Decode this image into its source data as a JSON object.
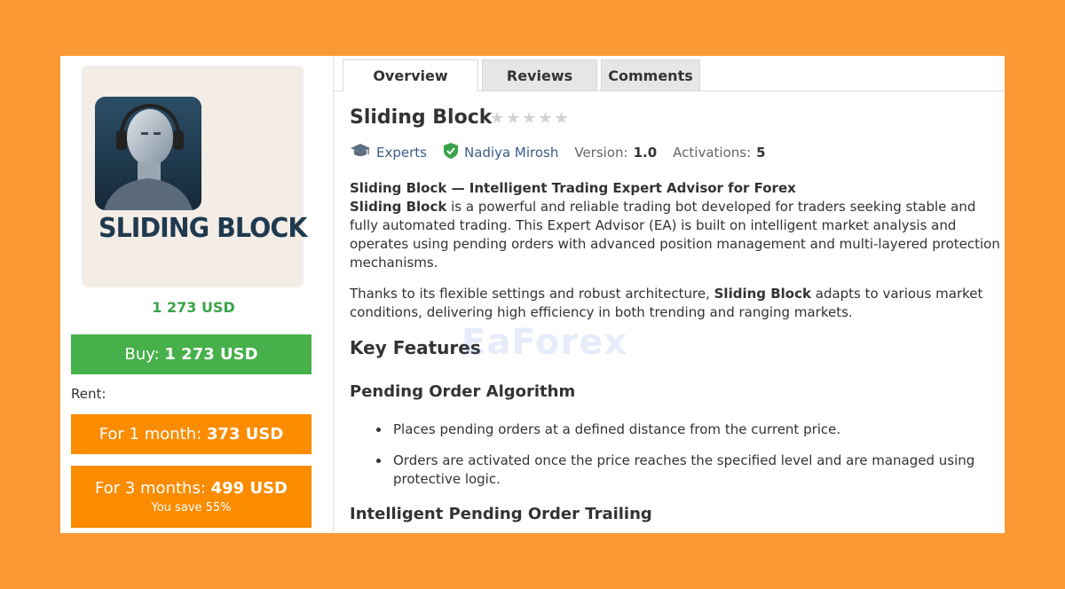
{
  "product": {
    "logo_text": "SLIDING BLOCK",
    "price": "1 273 USD",
    "buy": {
      "prefix": "Buy:",
      "amount": "1 273 USD"
    },
    "rent_label": "Rent:",
    "rent_options": [
      {
        "label": "For 1 month:",
        "amount": "373 USD",
        "note": ""
      },
      {
        "label": "For 3 months:",
        "amount": "499 USD",
        "note": "You save 55%"
      }
    ]
  },
  "tabs": [
    "Overview",
    "Reviews",
    "Comments"
  ],
  "header": {
    "title": "Sliding Block",
    "rating_stars": 0,
    "category": "Experts",
    "author": "Nadiya Mirosh",
    "version_label": "Version:",
    "version_value": "1.0",
    "activations_label": "Activations:",
    "activations_value": "5"
  },
  "description": {
    "heading": "Sliding Block — Intelligent Trading Expert Advisor for Forex",
    "p1_bold": "Sliding Block",
    "p1_rest": " is a powerful and reliable trading bot developed for traders seeking stable and fully automated trading. This Expert Advisor (EA) is built on intelligent market analysis and operates using pending orders with advanced position management and multi-layered protection mechanisms.",
    "p2_start": "Thanks to its flexible settings and robust architecture, ",
    "p2_bold": "Sliding Block",
    "p2_rest": " adapts to various market conditions, delivering high efficiency in both trending and ranging markets.",
    "key_features": "Key Features",
    "section1_title": "Pending Order Algorithm",
    "section1_bullets": [
      "Places pending orders at a defined distance from the current price.",
      "Orders are activated once the price reaches the specified level and are managed using protective logic."
    ],
    "section2_title": "Intelligent Pending Order Trailing"
  },
  "watermark": "EaForex",
  "colors": {
    "background": "#fb9a34",
    "buy": "#46b04a",
    "rent": "#fb8c00",
    "price": "#3aa34a",
    "link": "#3c5b8a"
  }
}
